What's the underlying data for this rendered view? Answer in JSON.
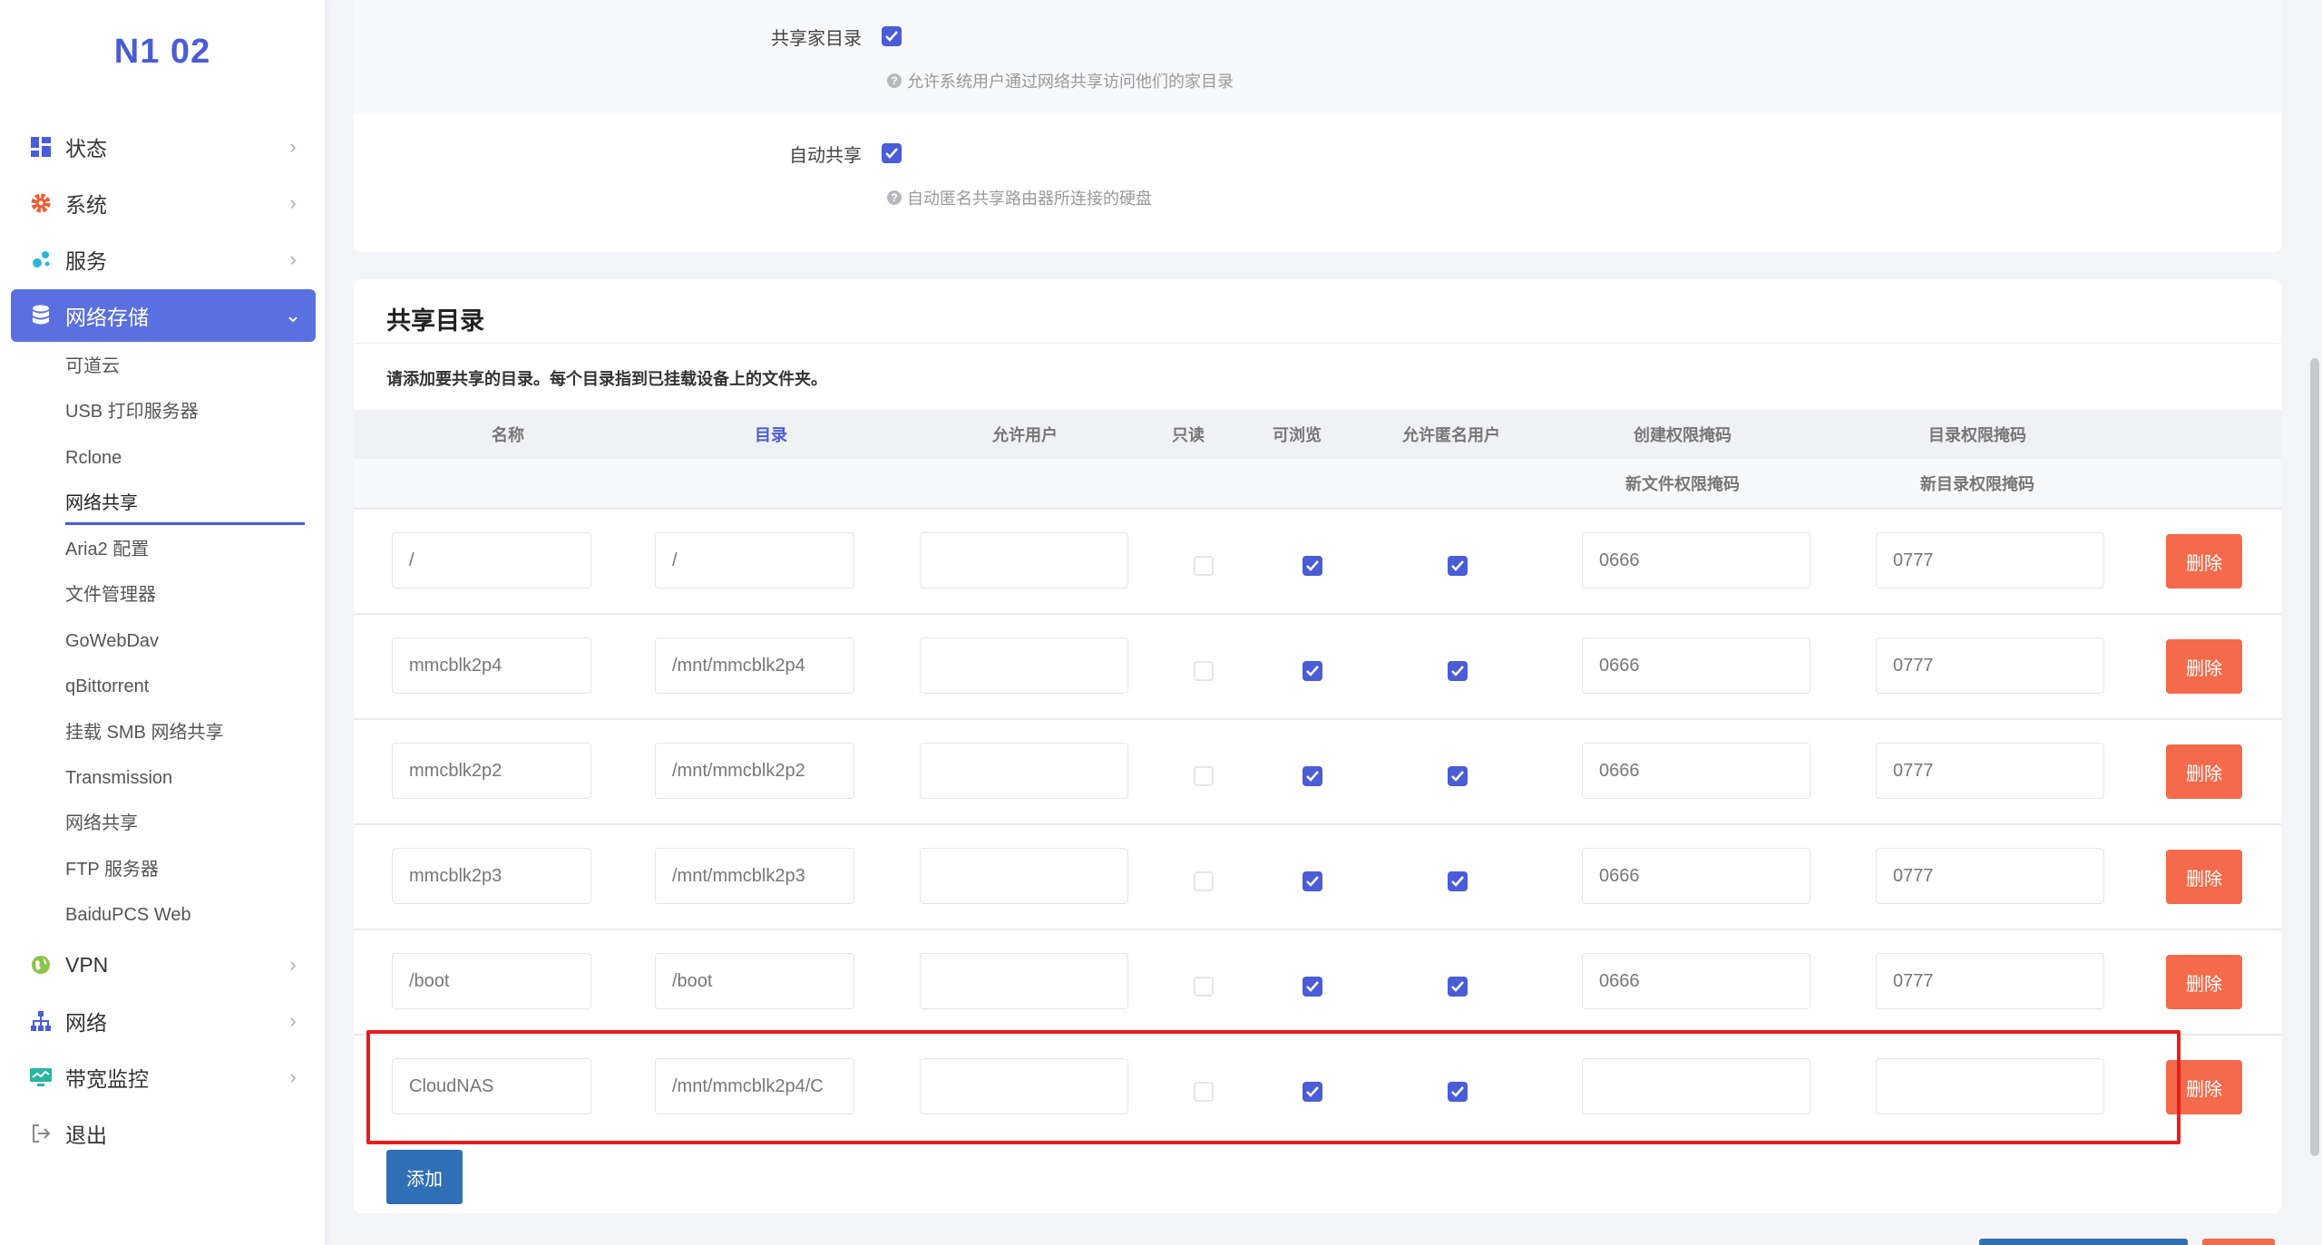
{
  "brand": "N1 02",
  "sidebar": {
    "items": [
      {
        "label": "状态",
        "icon": "dashboard-icon",
        "color": "#4a5cd6"
      },
      {
        "label": "系统",
        "icon": "gear-icon",
        "color": "#f25a2a"
      },
      {
        "label": "服务",
        "icon": "puzzle-icon",
        "color": "#2bb5d8"
      },
      {
        "label": "网络存储",
        "icon": "database-icon",
        "color": "#ffffff"
      },
      {
        "label": "VPN",
        "icon": "globe-icon",
        "color": "#8bc34a"
      },
      {
        "label": "网络",
        "icon": "sitemap-icon",
        "color": "#4a5cd6"
      },
      {
        "label": "带宽监控",
        "icon": "monitor-icon",
        "color": "#2bb5a0"
      },
      {
        "label": "退出",
        "icon": "logout-icon",
        "color": "#888888"
      }
    ],
    "submenu": [
      "可道云",
      "USB 打印服务器",
      "Rclone",
      "网络共享",
      "Aria2 配置",
      "文件管理器",
      "GoWebDav",
      "qBittorrent",
      "挂载 SMB 网络共享",
      "Transmission",
      "网络共享",
      "FTP 服务器",
      "BaiduPCS Web"
    ]
  },
  "options": {
    "home_share_label": "共享家目录",
    "home_share_desc": "允许系统用户通过网络共享访问他们的家目录",
    "auto_share_label": "自动共享",
    "auto_share_desc": "自动匿名共享路由器所连接的硬盘"
  },
  "share": {
    "title": "共享目录",
    "desc": "请添加要共享的目录。每个目录指到已挂载设备上的文件夹。",
    "columns": {
      "name": "名称",
      "path": "目录",
      "users": "允许用户",
      "readonly": "只读",
      "browseable": "可浏览",
      "guest": "允许匿名用户",
      "create_mask": "创建权限掩码",
      "dir_mask": "目录权限掩码",
      "create_mask_sub": "新文件权限掩码",
      "dir_mask_sub": "新目录权限掩码"
    },
    "rows": [
      {
        "name": "/",
        "path": "/",
        "users": "",
        "create_mask": "0666",
        "dir_mask": "0777"
      },
      {
        "name": "mmcblk2p4",
        "path": "/mnt/mmcblk2p4",
        "users": "",
        "create_mask": "0666",
        "dir_mask": "0777"
      },
      {
        "name": "mmcblk2p2",
        "path": "/mnt/mmcblk2p2",
        "users": "",
        "create_mask": "0666",
        "dir_mask": "0777"
      },
      {
        "name": "mmcblk2p3",
        "path": "/mnt/mmcblk2p3",
        "users": "",
        "create_mask": "0666",
        "dir_mask": "0777"
      },
      {
        "name": "/boot",
        "path": "/boot",
        "users": "",
        "create_mask": "0666",
        "dir_mask": "0777"
      },
      {
        "name": "CloudNAS",
        "path": "/mnt/mmcblk2p4/C",
        "users": "",
        "create_mask": "",
        "dir_mask": ""
      }
    ],
    "delete_label": "删除",
    "add_label": "添加"
  },
  "colors": {
    "accent": "#4a5cd6",
    "danger": "#f46a4a",
    "primary": "#2f6fb5",
    "highlight": "#e81c1c"
  }
}
